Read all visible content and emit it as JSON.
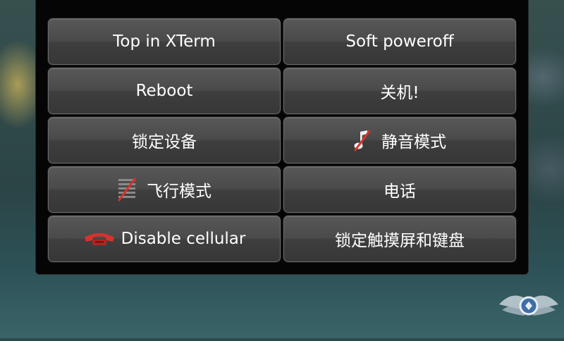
{
  "menu": {
    "buttons": [
      {
        "label": "Top in XTerm"
      },
      {
        "label": "Soft poweroff"
      },
      {
        "label": "Reboot"
      },
      {
        "label": "关机!"
      },
      {
        "label": "锁定设备"
      },
      {
        "label": "静音模式",
        "icon": "silent-mode-icon"
      },
      {
        "label": "飞行模式",
        "icon": "flight-mode-icon"
      },
      {
        "label": "电话"
      },
      {
        "label": "Disable cellular",
        "icon": "red-phone-icon"
      },
      {
        "label": "锁定触摸屏和键盘"
      }
    ]
  },
  "colors": {
    "accent_red": "#d8322c",
    "button_text": "#ffffff"
  },
  "watermark": {
    "icon": "winged-logo-icon"
  }
}
